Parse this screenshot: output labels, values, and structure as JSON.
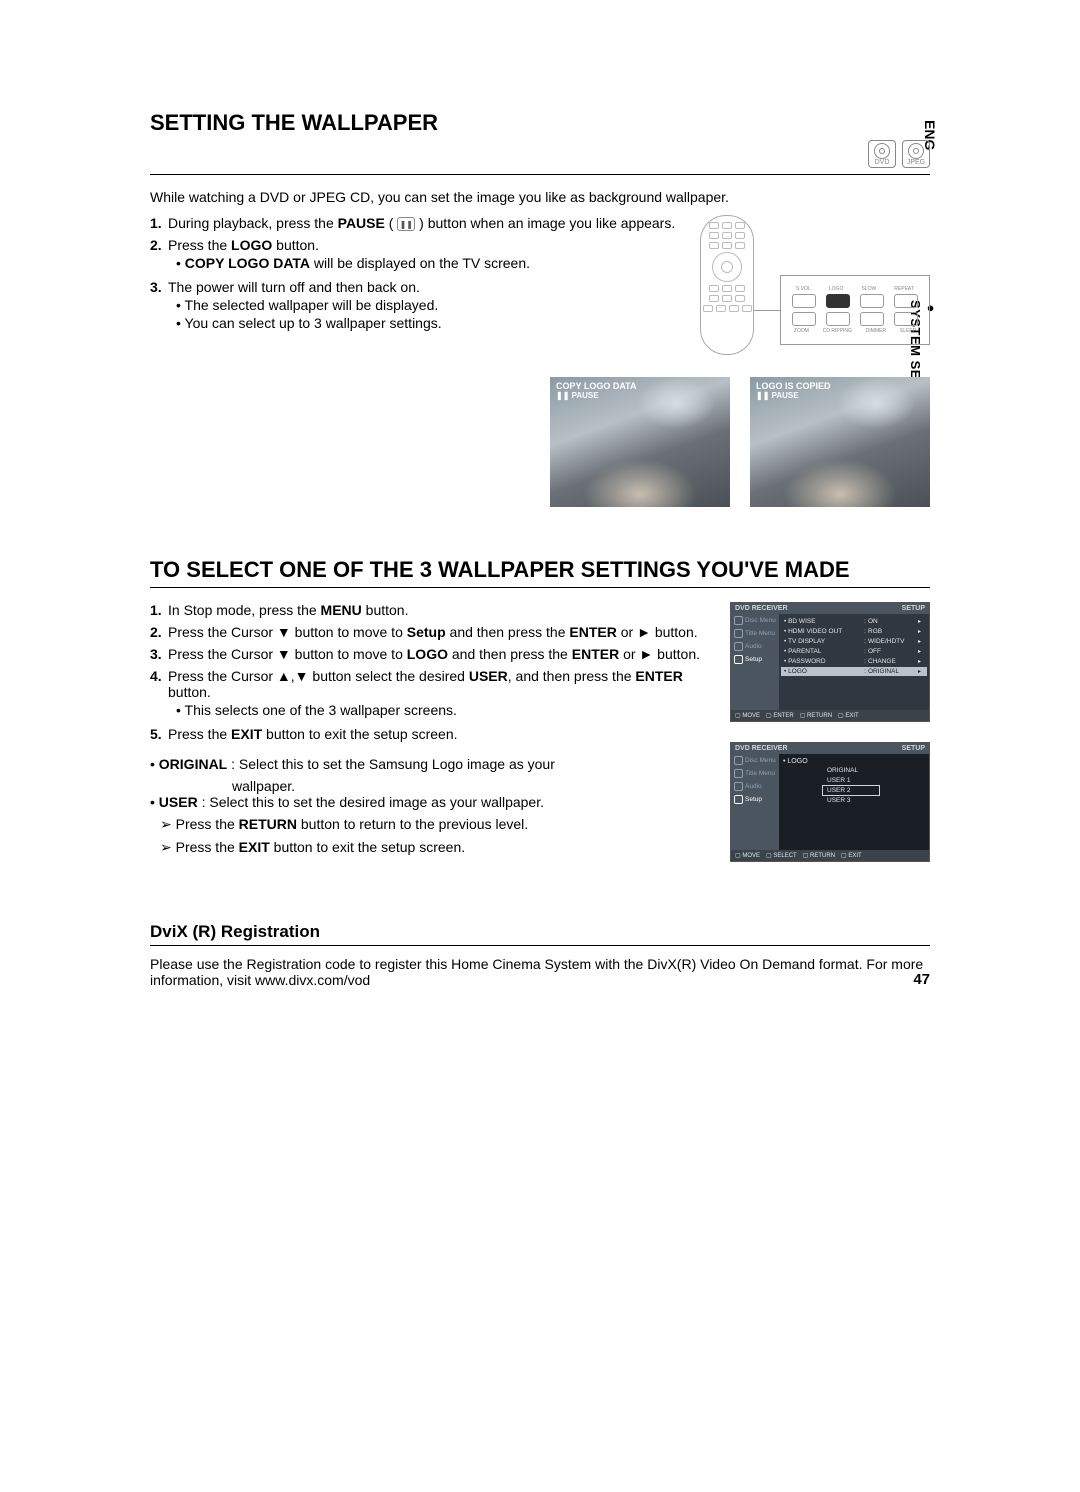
{
  "lang_tab": "ENG",
  "side_section": "SYSTEM SETUP",
  "page_number": "47",
  "section1": {
    "title": "SETTING THE WALLPAPER",
    "icons": {
      "dvd": "DVD",
      "jpeg": "JPEG"
    },
    "intro": "While watching a DVD or JPEG CD, you can set the image you like as background wallpaper.",
    "steps": {
      "s1_a": "During playback, press the ",
      "s1_b": "PAUSE",
      "s1_c": " ( ",
      "s1_d": " ) button when an image you like appears.",
      "s2_a": "Press the ",
      "s2_b": "LOGO",
      "s2_c": " button.",
      "s2_bullet_a": "COPY LOGO DATA",
      "s2_bullet_b": " will be displayed on the TV screen.",
      "s3": "The power will turn off and then back on.",
      "s3_bullet1": "The selected wallpaper will be displayed.",
      "s3_bullet2": "You can select up to 3 wallpaper settings."
    },
    "remote": {
      "row1": [
        "S.VOL",
        "LOGO",
        "SLOW",
        "REPEAT"
      ],
      "row2": [
        "ZOOM",
        "CD RIPPING",
        "DIMMER",
        "SLEEP"
      ],
      "highlight": "LOGO"
    },
    "photo1_label": "COPY LOGO DATA",
    "photo2_label": "LOGO IS COPIED",
    "photo_pause": "❚❚ PAUSE"
  },
  "section2": {
    "title": "TO SELECT ONE OF THE 3 WALLPAPER SETTINGS YOU'VE MADE",
    "steps": {
      "s1_a": "In Stop mode, press the ",
      "s1_b": "MENU",
      "s1_c": " button.",
      "s2_a": "Press the Cursor ▼ button to move to ",
      "s2_b": "Setup",
      "s2_c": " and then press the ",
      "s2_d": "ENTER",
      "s2_e": " or ► button.",
      "s3_a": "Press the Cursor ▼ button to move to ",
      "s3_b": "LOGO",
      "s3_c": " and then press the ",
      "s3_d": "ENTER",
      "s3_e": " or ► button.",
      "s4_a": "Press the Cursor ▲,▼ button select the desired ",
      "s4_b": "USER",
      "s4_c": ", and then press the ",
      "s4_d": "ENTER",
      "s4_e": " button.",
      "s4_bullet": "This selects one of the 3 wallpaper screens.",
      "s5_a": "Press the ",
      "s5_b": "EXIT",
      "s5_c": " button to exit the setup screen."
    },
    "options": {
      "original_name": "ORIGINAL",
      "original_desc1": " : Select this to set the Samsung Logo image as your",
      "original_desc2": "wallpaper.",
      "user_name": "USER",
      "user_desc": " : Select this to set the desired image as your wallpaper."
    },
    "notes": {
      "n1_a": "Press the ",
      "n1_b": "RETURN",
      "n1_c": " button to return to the previous level.",
      "n2_a": "Press the ",
      "n2_b": "EXIT",
      "n2_c": " button to exit the setup screen."
    },
    "osd1": {
      "brand": "DVD RECEIVER",
      "mode": "SETUP",
      "side": [
        "Disc Menu",
        "Title Menu",
        "Audio",
        "Setup"
      ],
      "rows": [
        {
          "k": "BD WISE",
          "v": "ON"
        },
        {
          "k": "HDMI VIDEO OUT",
          "v": "RGB"
        },
        {
          "k": "TV DISPLAY",
          "v": "WIDE/HDTV"
        },
        {
          "k": "PARENTAL",
          "v": "OFF"
        },
        {
          "k": "PASSWORD",
          "v": "CHANGE"
        },
        {
          "k": "LOGO",
          "v": "ORIGINAL",
          "sel": true
        }
      ],
      "footer": [
        "MOVE",
        "ENTER",
        "RETURN",
        "EXIT"
      ]
    },
    "osd2": {
      "brand": "DVD RECEIVER",
      "mode": "SETUP",
      "side": [
        "Disc Menu",
        "Title Menu",
        "Audio",
        "Setup"
      ],
      "row_key": "LOGO",
      "options": [
        "ORIGINAL",
        "USER 1",
        "USER 2",
        "USER 3"
      ],
      "selected": "USER 2",
      "footer": [
        "MOVE",
        "SELECT",
        "RETURN",
        "EXIT"
      ]
    }
  },
  "section3": {
    "title": "DviX (R) Registration",
    "text": "Please use the Registration code to register this Home Cinema System with the DivX(R) Video On Demand format. For more information, visit www.divx.com/vod"
  }
}
